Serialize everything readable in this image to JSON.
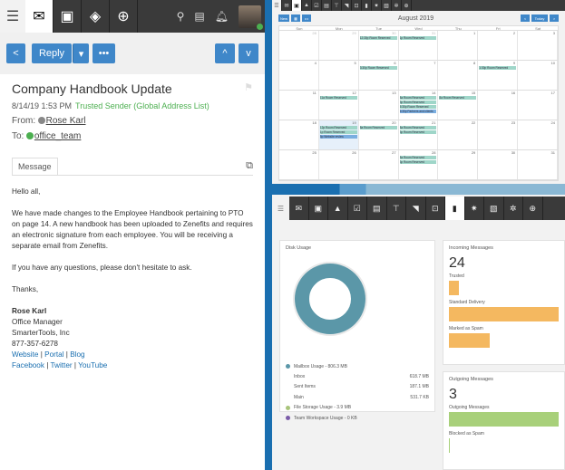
{
  "email": {
    "toolbar": {
      "icons": [
        "hamburger-icon",
        "mail-icon",
        "calendar-icon",
        "layers-icon",
        "add-icon",
        "search-icon",
        "chat-icon",
        "bell-icon"
      ]
    },
    "actions": {
      "back": "<",
      "reply": "Reply",
      "more": "•••",
      "up": "^",
      "down": "v"
    },
    "subject": "Company Handbook Update",
    "date": "8/14/19 1:53 PM",
    "trusted": "Trusted Sender (Global Address List)",
    "from_label": "From:",
    "from": "Rose Karl",
    "to_label": "To:",
    "to": "office_team",
    "tab": "Message",
    "body": {
      "greeting": "Hello all,",
      "p1": "We have made changes to the Employee Handbook pertaining to PTO on page 14.  A new handbook has been uploaded to Zenefits and requires an electronic signature from each employee.  You will be receiving a separate email from Zenefits.",
      "p2": "If you have any questions, please don't hesitate to ask.",
      "thanks": "Thanks,",
      "sig_name": "Rose Karl",
      "sig_title": "Office Manager",
      "sig_company": "SmarterTools, Inc",
      "sig_phone": "877-357-6278",
      "links1": [
        "Website",
        "Portal",
        "Blog"
      ],
      "links2": [
        "Facebook",
        "Twitter",
        "YouTube"
      ],
      "sep": " | "
    }
  },
  "calendar": {
    "new": "New",
    "more": "•••",
    "prev": "<",
    "today": "Today",
    "next": ">",
    "month": "August 2019",
    "days": [
      "Sun",
      "Mon",
      "Tue",
      "Wed",
      "Thu",
      "Fri",
      "Sat"
    ],
    "weeks": [
      [
        {
          "n": "28",
          "o": true
        },
        {
          "n": "29",
          "o": true
        },
        {
          "n": "30",
          "o": true,
          "ev": [
            "12:30p Room Reserved"
          ]
        },
        {
          "n": "31",
          "o": true,
          "ev": [
            "1p Room Reserved"
          ]
        },
        {
          "n": "1"
        },
        {
          "n": "2"
        },
        {
          "n": "3"
        }
      ],
      [
        {
          "n": "4"
        },
        {
          "n": "5"
        },
        {
          "n": "6",
          "ev": [
            "3:30p Room Reserved"
          ]
        },
        {
          "n": "7"
        },
        {
          "n": "8"
        },
        {
          "n": "9",
          "ev": [
            "1:30p Room Reserved"
          ]
        },
        {
          "n": "10"
        }
      ],
      [
        {
          "n": "11"
        },
        {
          "n": "12",
          "ev": [
            "11a Room Reserved"
          ]
        },
        {
          "n": "13"
        },
        {
          "n": "14",
          "ev": [
            "8a Room Reserved",
            "3p Room Reserved",
            "5:30p Room Reserved"
          ],
          "evb": [
            "6:30p Partners and clients"
          ]
        },
        {
          "n": "15",
          "ev": [
            "8a Room Reserved"
          ]
        },
        {
          "n": "16"
        },
        {
          "n": "17"
        }
      ],
      [
        {
          "n": "18"
        },
        {
          "n": "19",
          "t": true,
          "ev": [
            "12p Room Reserved",
            "1p Room Reserved"
          ],
          "evb": [
            "5p Website review"
          ]
        },
        {
          "n": "20",
          "ev": [
            "8a Room Reserved"
          ]
        },
        {
          "n": "21",
          "ev": [
            "8a Room Reserved",
            "3p Room Reserved"
          ]
        },
        {
          "n": "22"
        },
        {
          "n": "23"
        },
        {
          "n": "24"
        }
      ],
      [
        {
          "n": "25"
        },
        {
          "n": "26"
        },
        {
          "n": "27"
        },
        {
          "n": "28",
          "ev": [
            "8a Room Reserved",
            "3p Room Reserved"
          ]
        },
        {
          "n": "29"
        },
        {
          "n": "30"
        },
        {
          "n": "31"
        }
      ]
    ]
  },
  "dashboard": {
    "toolbar_icons": [
      "mail-icon",
      "calendar-icon",
      "contacts-icon",
      "tasks-icon",
      "notes-icon",
      "sitemap-icon",
      "rss-icon",
      "inbox-icon",
      "chart-icon",
      "settings-icon",
      "reports-icon",
      "gears-icon",
      "add-icon"
    ],
    "active_icon": "chart-icon",
    "disk": {
      "title": "Disk Usage",
      "mailbox": "Mailbox Usage - 806.3 MB",
      "rows": [
        {
          "label": "Inbox",
          "value": "618.7 MB"
        },
        {
          "label": "Sent Items",
          "value": "187.1 MB"
        },
        {
          "label": "Main",
          "value": "531.7 KB"
        }
      ],
      "files": "File Storage Usage - 3.9 MB",
      "team": "Team Workspace Usage - 0 KB",
      "colors": {
        "mailbox": "#5b97a8",
        "files": "#a8c47a",
        "team": "#7a5ba8"
      }
    },
    "incoming": {
      "title": "Incoming Messages",
      "total": "24",
      "bars": [
        {
          "label": "Trusted",
          "fraction": 0.09
        },
        {
          "label": "Standard Delivery",
          "fraction": 1.0
        },
        {
          "label": "Marked as Spam",
          "fraction": 0.37
        }
      ],
      "color": "#f4b860"
    },
    "outgoing": {
      "title": "Outgoing Messages",
      "total": "3",
      "bars": [
        {
          "label": "Outgoing Messages",
          "fraction": 1.0
        },
        {
          "label": "Blocked as Spam",
          "fraction": 0
        }
      ],
      "color": "#a8d07a"
    }
  }
}
